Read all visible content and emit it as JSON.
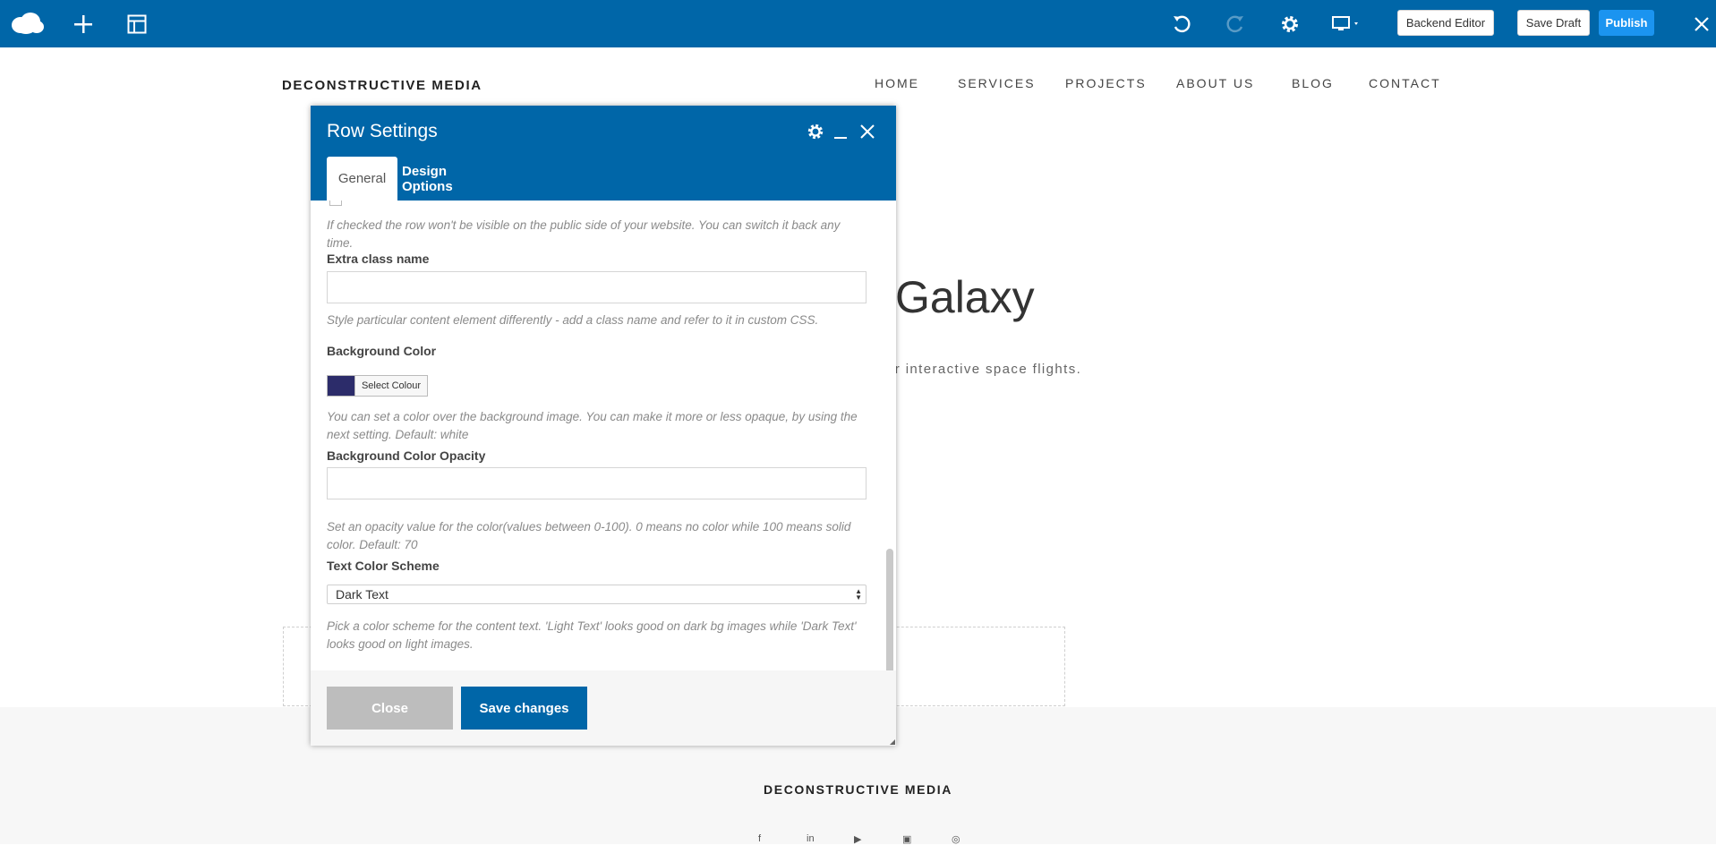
{
  "toolbar": {
    "backend_editor": "Backend Editor",
    "save_draft": "Save Draft",
    "publish": "Publish",
    "accent": "#0066a8",
    "publish_color": "#1b94f0",
    "icons": [
      "cloud-logo-icon",
      "add-icon",
      "layout-icon",
      "undo-icon",
      "redo-icon",
      "gear-icon",
      "desktop-view-icon",
      "close-icon"
    ]
  },
  "site": {
    "logo": "DECONSTRUCTIVE MEDIA",
    "nav": [
      "HOME",
      "SERVICES",
      "PROJECTS",
      "ABOUT US",
      "BLOG",
      "CONTACT"
    ],
    "hero_title_fragment": "Galaxy",
    "hero_sub_fragment": "ur interactive space flights.",
    "footer_logo": "DECONSTRUCTIVE MEDIA",
    "social_icons": [
      "facebook-icon",
      "linkedin-icon",
      "youtube-icon",
      "vimeo-icon",
      "instagram-icon"
    ]
  },
  "modal": {
    "title": "Row Settings",
    "tabs": [
      {
        "label": "General",
        "active": true
      },
      {
        "label": "Design Options",
        "active": false
      }
    ],
    "hide_row_help": "If checked the row won't be visible on the public side of your website. You can switch it back any time.",
    "extra_class": {
      "label": "Extra class name",
      "value": "",
      "help": "Style particular content element differently - add a class name and refer to it in custom CSS."
    },
    "background_color": {
      "label": "Background Color",
      "swatch": "#2c2c6a",
      "button": "Select Colour",
      "help": "You can set a color over the background image. You can make it more or less opaque, by using the next setting. Default: white"
    },
    "bg_opacity": {
      "label": "Background Color Opacity",
      "value": "",
      "help": "Set an opacity value for the color(values between 0-100). 0 means no color while 100 means solid color. Default: 70"
    },
    "text_scheme": {
      "label": "Text Color Scheme",
      "selected": "Dark Text",
      "help": "Pick a color scheme for the content text. 'Light Text' looks good on dark bg images while 'Dark Text' looks good on light images."
    },
    "close_label": "Close",
    "save_label": "Save changes"
  }
}
